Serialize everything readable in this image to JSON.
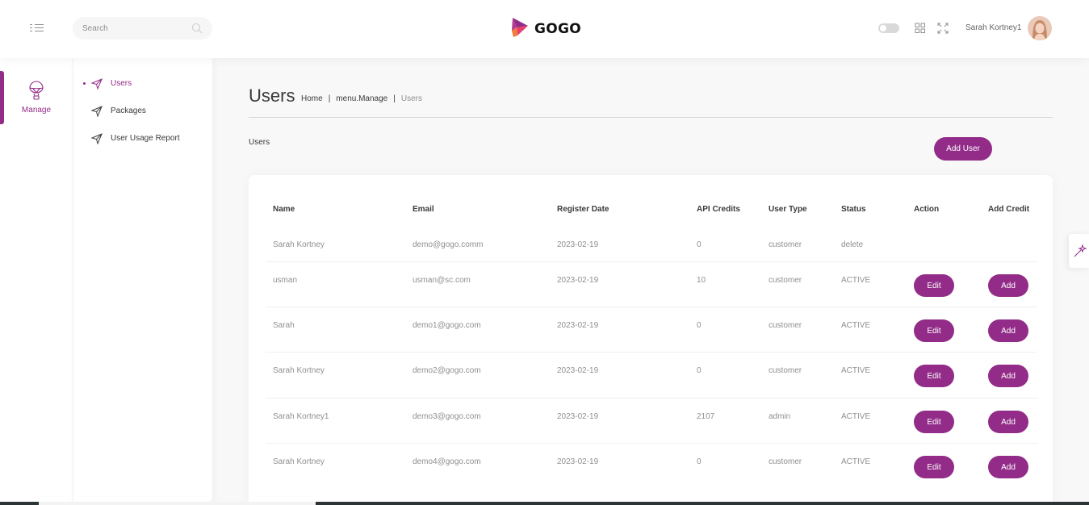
{
  "header": {
    "search_placeholder": "Search",
    "logo_text": "GOGO",
    "user_name": "Sarah Kortney1"
  },
  "main_menu": {
    "items": [
      {
        "label": "Manage",
        "icon": "balloon-icon",
        "active": true
      }
    ]
  },
  "sub_menu": {
    "items": [
      {
        "label": "Users",
        "icon": "send-icon",
        "active": true
      },
      {
        "label": "Packages",
        "icon": "send-icon",
        "active": false
      },
      {
        "label": "User Usage Report",
        "icon": "send-icon",
        "active": false
      }
    ]
  },
  "page": {
    "title": "Users",
    "breadcrumb": [
      "Home",
      "menu.Manage",
      "Users"
    ],
    "section_label": "Users",
    "add_user_label": "Add User"
  },
  "table": {
    "columns": [
      "Name",
      "Email",
      "Register Date",
      "API Credits",
      "User Type",
      "Status",
      "Action",
      "Add Credit"
    ],
    "edit_label": "Edit",
    "add_label": "Add",
    "rows": [
      {
        "name": "Sarah Kortney",
        "email": "demo@gogo.comm",
        "date": "2023-02-19",
        "credits": "0",
        "type": "customer",
        "status": "delete",
        "has_actions": false
      },
      {
        "name": "usman",
        "email": "usman@sc.com",
        "date": "2023-02-19",
        "credits": "10",
        "type": "customer",
        "status": "ACTIVE",
        "has_actions": true
      },
      {
        "name": "Sarah",
        "email": "demo1@gogo.com",
        "date": "2023-02-19",
        "credits": "0",
        "type": "customer",
        "status": "ACTIVE",
        "has_actions": true
      },
      {
        "name": "Sarah Kortney",
        "email": "demo2@gogo.com",
        "date": "2023-02-19",
        "credits": "0",
        "type": "customer",
        "status": "ACTIVE",
        "has_actions": true
      },
      {
        "name": "Sarah Kortney1",
        "email": "demo3@gogo.com",
        "date": "2023-02-19",
        "credits": "2107",
        "type": "admin",
        "status": "ACTIVE",
        "has_actions": true
      },
      {
        "name": "Sarah Kortney",
        "email": "demo4@gogo.com",
        "date": "2023-02-19",
        "credits": "0",
        "type": "customer",
        "status": "ACTIVE",
        "has_actions": true
      }
    ]
  },
  "colors": {
    "accent": "#922c88",
    "text": "#3a3a3a",
    "muted": "#8f8f8f",
    "background": "#f8f8f8"
  }
}
